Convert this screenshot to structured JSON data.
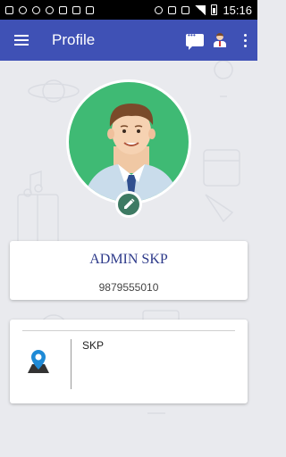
{
  "status_bar": {
    "time": "15:16"
  },
  "app_bar": {
    "title": "Profile",
    "colors": {
      "primary": "#3f51b5"
    }
  },
  "profile": {
    "name": "ADMIN SKP",
    "phone": "9879555010",
    "address": "SKP"
  },
  "icons": [
    "menu-icon",
    "chat-icon",
    "profile-icon",
    "overflow-menu-icon",
    "edit-pencil-icon",
    "location-pin-icon"
  ],
  "colors": {
    "avatar_bg": "#3fba74",
    "edit_badge": "#3d7a63",
    "location_pin": "#1e8ad6",
    "name_text": "#2d3a8a"
  }
}
